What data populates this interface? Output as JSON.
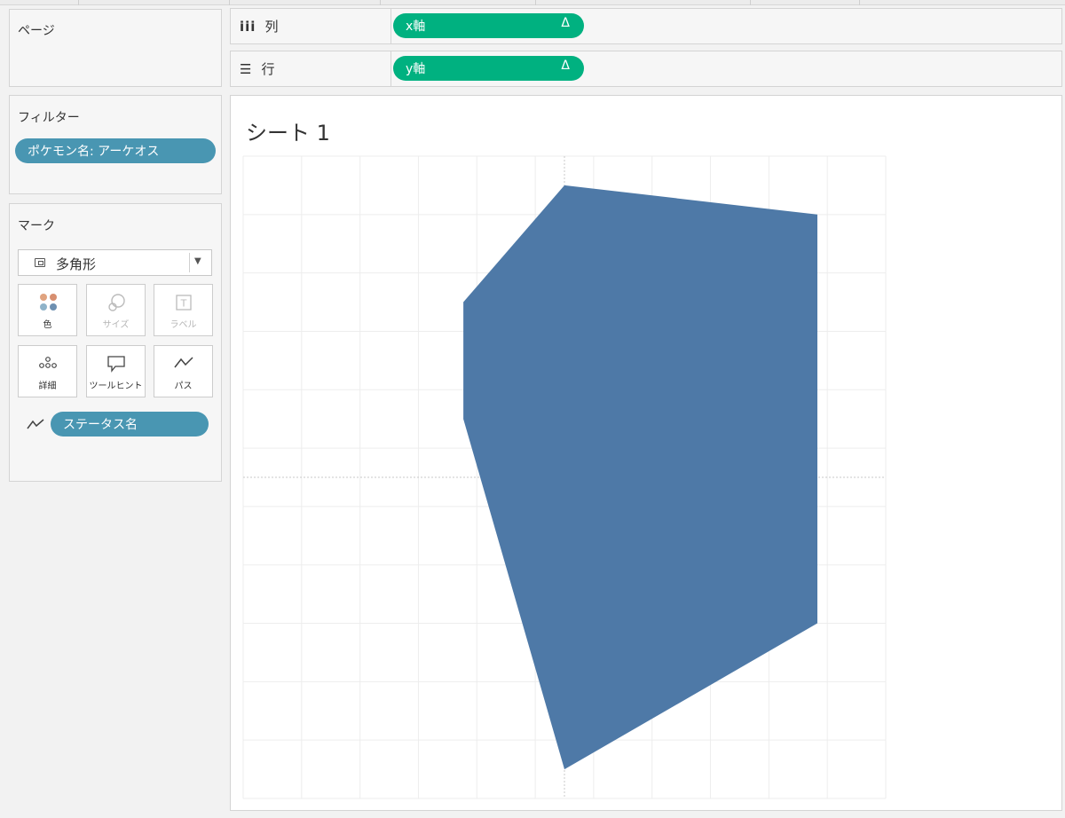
{
  "pages_card": {
    "title": "ページ"
  },
  "filters_card": {
    "title": "フィルター",
    "pills": [
      {
        "label": "ポケモン名: アーケオス"
      }
    ]
  },
  "marks_card": {
    "title": "マーク",
    "mark_type": {
      "label": "多角形",
      "icon": "polygon-mark-icon"
    },
    "buttons": [
      {
        "label": "色",
        "icon": "color-dots-icon",
        "enabled": true
      },
      {
        "label": "サイズ",
        "icon": "size-circles-icon",
        "enabled": false
      },
      {
        "label": "ラベル",
        "icon": "label-t-icon",
        "enabled": false
      },
      {
        "label": "詳細",
        "icon": "detail-dots-icon",
        "enabled": true
      },
      {
        "label": "ツールヒント",
        "icon": "tooltip-bubble-icon",
        "enabled": true
      },
      {
        "label": "パス",
        "icon": "path-line-icon",
        "enabled": true
      }
    ],
    "path_pill": {
      "label": "ステータス名",
      "icon": "path-line-icon"
    },
    "color_dots": [
      "#e0a37f",
      "#d78f70",
      "#8fb3c9",
      "#6e90b1"
    ]
  },
  "columns_shelf": {
    "label": "列",
    "icon": "columns-icon",
    "pill": "x軸",
    "pill_symbol": "Δ"
  },
  "rows_shelf": {
    "label": "行",
    "icon": "rows-icon",
    "pill": "y軸",
    "pill_symbol": "Δ"
  },
  "view": {
    "sheet_title": "シート 1"
  },
  "colors": {
    "measure_pill": "#00b180",
    "dimension_pill": "#4996b2",
    "polygon_fill": "#4e79a7"
  },
  "chart_data": {
    "type": "polygon",
    "xlim": [
      -11,
      11
    ],
    "ylim": [
      -11,
      11
    ],
    "grid": true,
    "zero_lines": true,
    "polygon": [
      {
        "x": 0.0,
        "y": 10.0
      },
      {
        "x": 8.66,
        "y": 9.0
      },
      {
        "x": 8.66,
        "y": -5.0
      },
      {
        "x": 0.0,
        "y": -10.0
      },
      {
        "x": -3.46,
        "y": 2.0
      },
      {
        "x": -3.46,
        "y": 6.0
      }
    ]
  }
}
